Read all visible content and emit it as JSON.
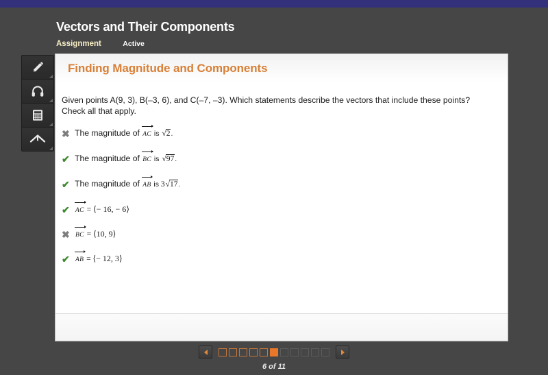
{
  "topbar": {
    "color": "#33307c"
  },
  "header": {
    "title": "Vectors and Their Components",
    "assignment_label": "Assignment",
    "status_label": "Active"
  },
  "toolbar": {
    "items": [
      {
        "icon": "pencil-icon",
        "name": "highlighter-tool"
      },
      {
        "icon": "headphones-icon",
        "name": "audio-tool"
      },
      {
        "icon": "calculator-icon",
        "name": "calculator-tool"
      },
      {
        "icon": "arrow-up-icon",
        "name": "scroll-up-tool"
      }
    ]
  },
  "card": {
    "title": "Finding Magnitude and Components",
    "question_line1": "Given points A(9, 3), B(–3, 6), and C(–7, –3). Which statements describe the vectors that include these points?",
    "question_line2": "Check all that apply.",
    "options": [
      {
        "mark": "cross",
        "mark_glyph": "✖",
        "prefix": "The magnitude of ",
        "vector": "AC",
        "middle": " is ",
        "radicand": "2",
        "coefficient": "",
        "suffix": ".",
        "text_full": "The magnitude of AC is √2."
      },
      {
        "mark": "check",
        "mark_glyph": "✔",
        "prefix": "The magnitude of ",
        "vector": "BC",
        "middle": " is ",
        "radicand": "97",
        "coefficient": "",
        "suffix": ".",
        "text_full": "The magnitude of BC is √97."
      },
      {
        "mark": "check",
        "mark_glyph": "✔",
        "prefix": "The magnitude of ",
        "vector": "AB",
        "middle": " is ",
        "radicand": "17",
        "coefficient": "3",
        "suffix": ".",
        "text_full": "The magnitude of AB is 3√17."
      },
      {
        "mark": "check",
        "mark_glyph": "✔",
        "vector": "AC",
        "equals": " = ",
        "components": "⟨− 16, − 6⟩",
        "text_full": "AC = ⟨−16, −6⟩"
      },
      {
        "mark": "cross",
        "mark_glyph": "✖",
        "vector": "BC",
        "equals": " = ",
        "components": "⟨10, 9⟩",
        "text_full": "BC = ⟨10, 9⟩"
      },
      {
        "mark": "check",
        "mark_glyph": "✔",
        "vector": "AB",
        "equals": " = ",
        "components": "⟨− 12, 3⟩",
        "text_full": "AB = ⟨−12, 3⟩"
      }
    ]
  },
  "pager": {
    "prev_label": "◀",
    "next_label": "▶",
    "current_page": 6,
    "total_pages": 11,
    "status": "6 of 11",
    "dots": [
      "visited",
      "visited",
      "visited",
      "visited",
      "visited",
      "current",
      "unvisited",
      "unvisited",
      "unvisited",
      "unvisited",
      "unvisited"
    ]
  },
  "colors": {
    "accent_orange": "#d87f36",
    "current_page": "#e8772a",
    "check_green": "#3c8a2e",
    "cross_grey": "#7d7d7d",
    "page_bg": "#474646",
    "topbar_purple": "#33307c"
  }
}
